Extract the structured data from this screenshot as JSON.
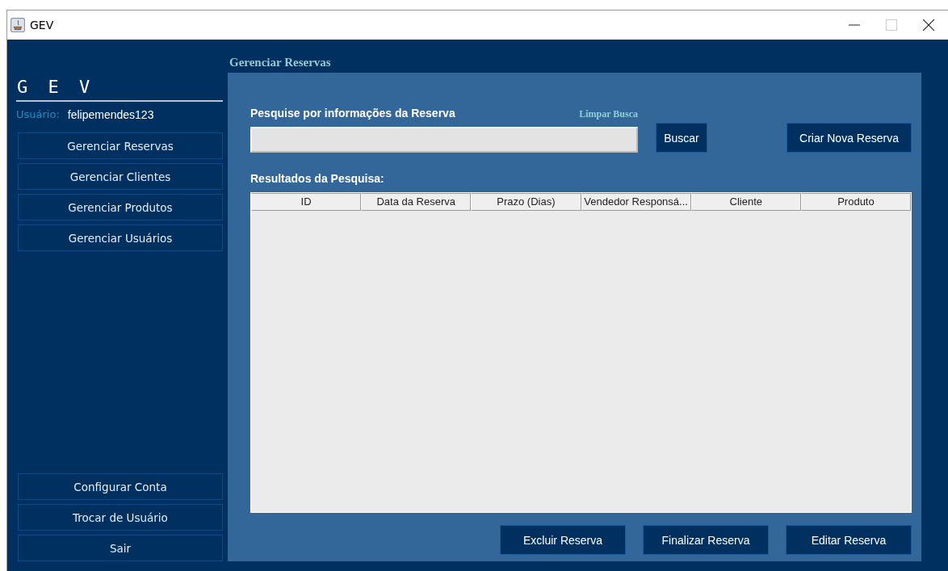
{
  "window": {
    "title": "GEV"
  },
  "sidebar": {
    "logo": "G E V",
    "user_label": "Usuário:",
    "user_name": "felipemendes123",
    "nav_items": [
      {
        "label": "Gerenciar Reservas"
      },
      {
        "label": "Gerenciar Clientes"
      },
      {
        "label": "Gerenciar Produtos"
      },
      {
        "label": "Gerenciar Usuários"
      }
    ],
    "bottom_items": [
      {
        "label": "Configurar Conta"
      },
      {
        "label": "Trocar de Usuário"
      },
      {
        "label": "Sair"
      }
    ]
  },
  "main": {
    "title": "Gerenciar Reservas",
    "search_label": "Pesquise por informações da Reserva",
    "clear_link": "Limpar Busca",
    "search_button": "Buscar",
    "create_button": "Criar Nova Reserva",
    "results_label": "Resultados da Pesquisa:",
    "table": {
      "columns": [
        "ID",
        "Data da Reserva",
        "Prazo (Dias)",
        "Vendedor Responsá...",
        "Cliente",
        "Produto"
      ]
    },
    "actions": [
      "Excluir Reserva",
      "Finalizar Reserva",
      "Editar Reserva"
    ]
  }
}
